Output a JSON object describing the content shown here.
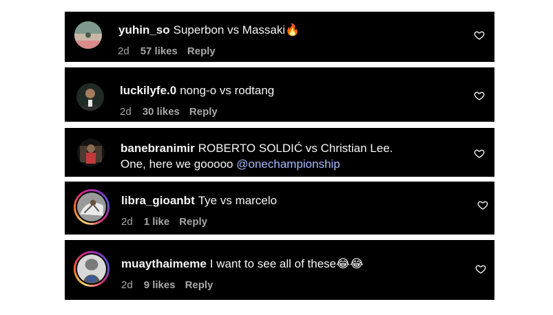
{
  "comments": [
    {
      "username": "yuhin_so",
      "text": "Superbon vs Massaki🔥",
      "mention": "",
      "time": "2d",
      "likes": "57 likes",
      "reply": "Reply"
    },
    {
      "username": "luckilyfe.0",
      "text": "nong-o vs rodtang",
      "mention": "",
      "time": "2d",
      "likes": "30 likes",
      "reply": "Reply"
    },
    {
      "username": "banebranimir",
      "text": "ROBERTO SOLDIĆ vs Christian Lee.",
      "text_line2": "One, here we gooooo",
      "mention": "@onechampionship",
      "time": "",
      "likes": "",
      "reply": ""
    },
    {
      "username": "libra_gioanbt",
      "text": "Tye vs marcelo",
      "mention": "",
      "time": "2d",
      "likes": "1 like",
      "reply": "Reply"
    },
    {
      "username": "muaythaimeme",
      "text": "I want to see all of these😂😂",
      "mention": "",
      "time": "2d",
      "likes": "9 likes",
      "reply": "Reply"
    }
  ],
  "icons": {
    "like": "heart-outline-icon"
  },
  "colors": {
    "card_background": "#000000",
    "text": "#f5f5f5",
    "meta": "#a8a8a8",
    "mention": "#a9b9ff"
  }
}
